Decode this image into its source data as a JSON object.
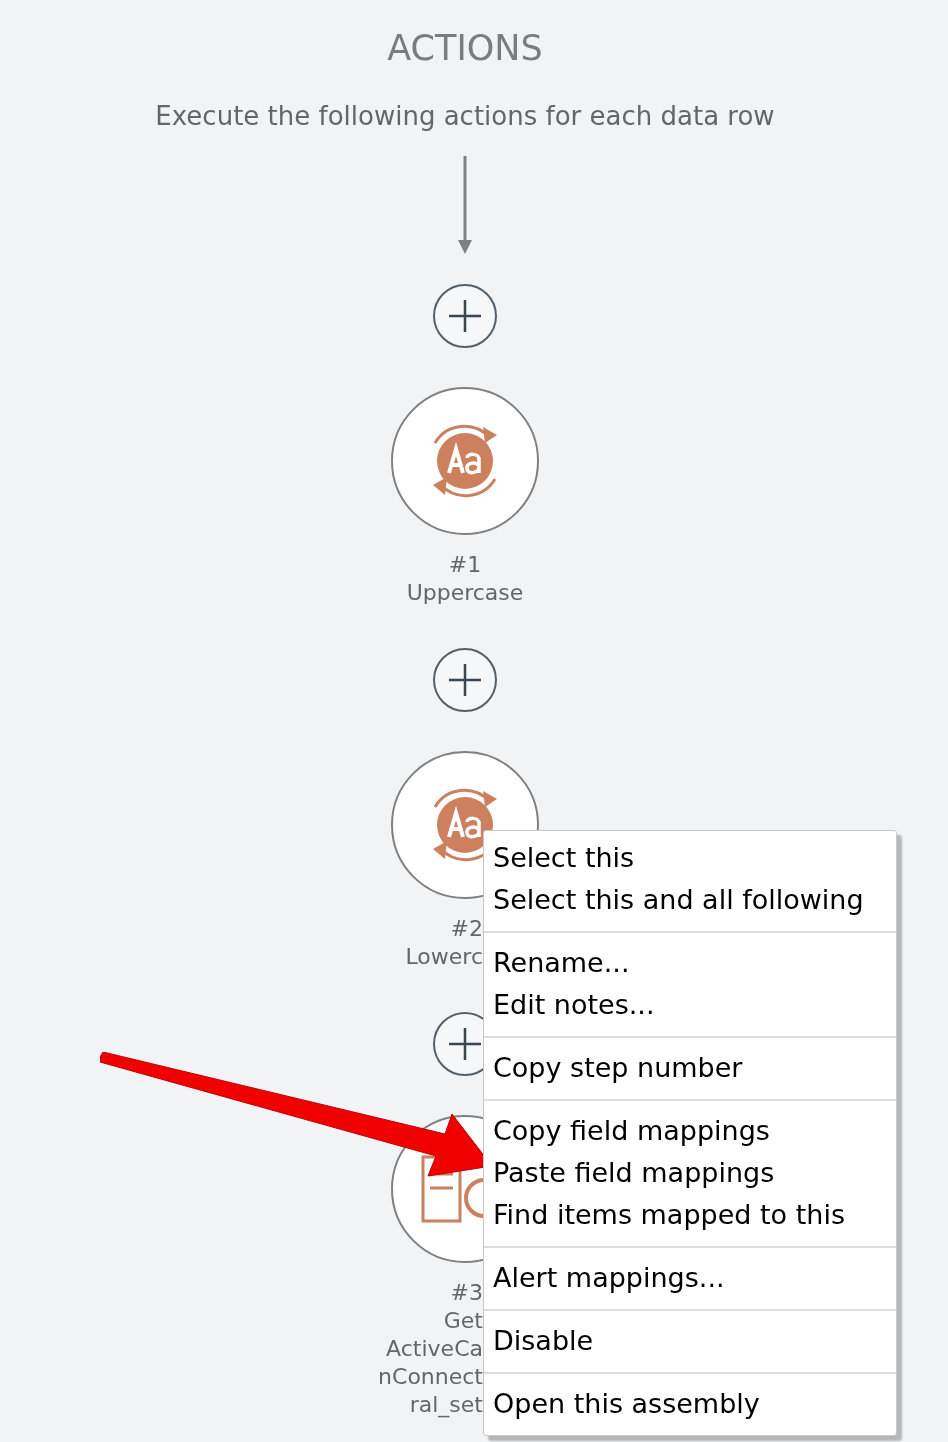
{
  "header": {
    "title": "ACTIONS",
    "subtitle": "Execute the following actions for each data row"
  },
  "steps": [
    {
      "kind": "case",
      "clipped": false,
      "label_lines": [
        "#1",
        "Uppercase"
      ]
    },
    {
      "kind": "case",
      "clipped": true,
      "label_lines": [
        "#2",
        "Lowerc"
      ]
    },
    {
      "kind": "document",
      "clipped": true,
      "label_lines": [
        "#3",
        "Get",
        "ActiveCa",
        "nConnect",
        "ral_set"
      ]
    }
  ],
  "context_menu": {
    "groups": [
      [
        "Select this",
        "Select this and all following"
      ],
      [
        "Rename...",
        "Edit notes..."
      ],
      [
        "Copy step number"
      ],
      [
        "Copy field mappings",
        "Paste field mappings",
        "Find items mapped to this"
      ],
      [
        "Alert mappings..."
      ],
      [
        "Disable"
      ],
      [
        "Open this assembly"
      ]
    ]
  }
}
